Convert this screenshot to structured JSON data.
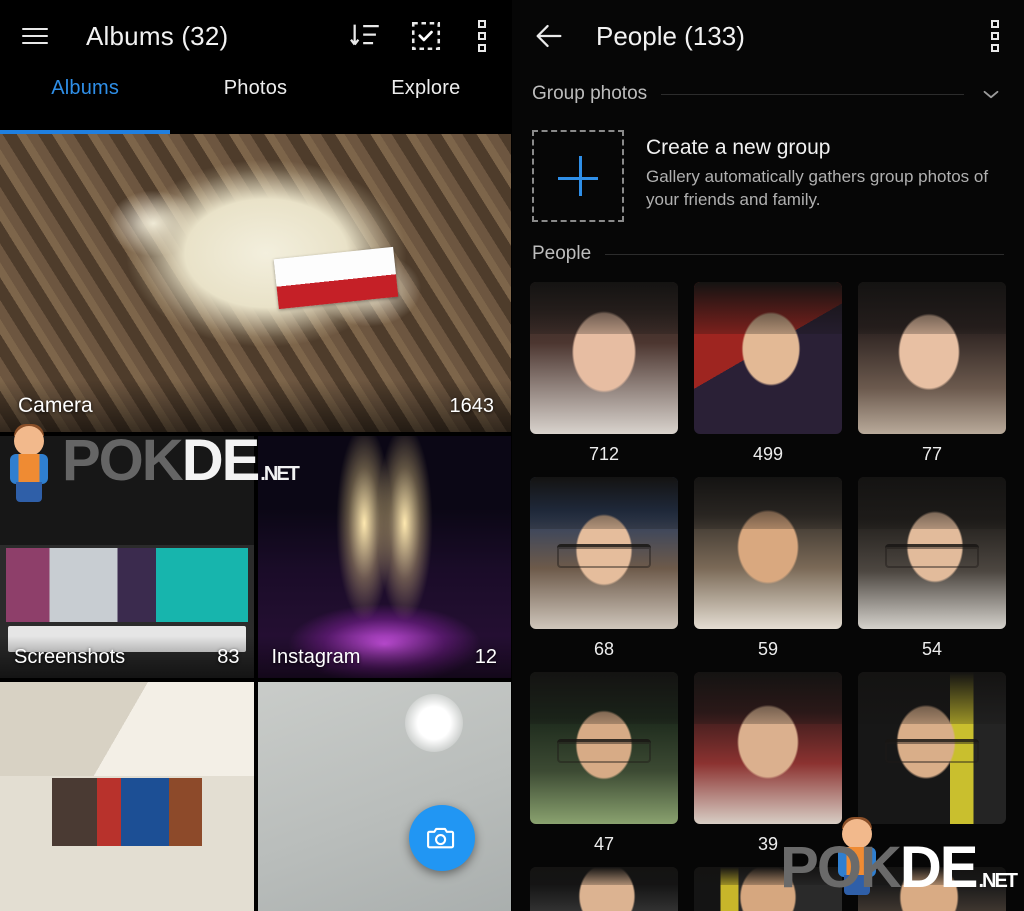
{
  "left": {
    "appbar": {
      "menu_icon": "hamburger-menu-icon",
      "title": "Albums (32)",
      "actions": [
        {
          "icon": "sort-icon",
          "name": "sort-button"
        },
        {
          "icon": "select-all-icon",
          "name": "select-button"
        },
        {
          "icon": "more-options-icon",
          "name": "more-options-button"
        }
      ]
    },
    "tabs": [
      {
        "label": "Albums",
        "active": true
      },
      {
        "label": "Photos",
        "active": false
      },
      {
        "label": "Explore",
        "active": false
      }
    ],
    "albums": [
      {
        "name": "Camera",
        "count": "1643"
      },
      {
        "name": "Screenshots",
        "count": "83"
      },
      {
        "name": "Instagram",
        "count": "12"
      },
      {
        "name": "",
        "count": ""
      },
      {
        "name": "",
        "count": ""
      }
    ],
    "fab": {
      "icon": "camera-icon",
      "color": "#2196f3"
    }
  },
  "right": {
    "appbar": {
      "back_icon": "back-arrow-icon",
      "title": "People (133)",
      "more_icon": "more-options-icon"
    },
    "group_photos": {
      "label": "Group photos",
      "chevron": "chevron-down-icon"
    },
    "create_group": {
      "title": "Create a new group",
      "subtitle": "Gallery automatically gathers group photos of your friends and family.",
      "plus_icon": "plus-icon",
      "plus_color": "#2f8fe8"
    },
    "people_section_label": "People",
    "people": [
      {
        "count": "712"
      },
      {
        "count": "499"
      },
      {
        "count": "77"
      },
      {
        "count": "68"
      },
      {
        "count": "59"
      },
      {
        "count": "54"
      },
      {
        "count": "47"
      },
      {
        "count": "39"
      },
      {
        "count": ""
      }
    ]
  },
  "watermark": {
    "pok": "POK",
    "de": "DE",
    "net": ".NET"
  },
  "colors": {
    "accent_blue": "#2f8fe8",
    "fab_blue": "#2196f3",
    "background": "#000000",
    "text_primary": "#f2f2f2",
    "text_secondary": "#b0b0b0"
  }
}
